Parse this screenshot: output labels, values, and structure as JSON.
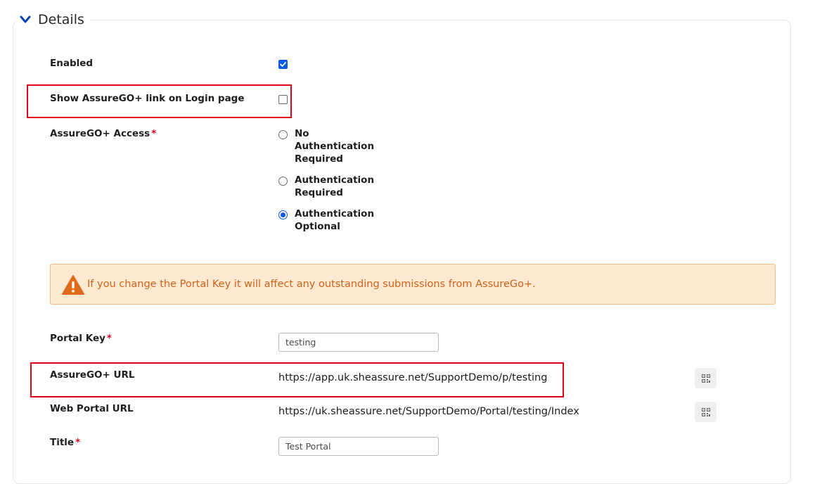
{
  "section": {
    "title": "Details"
  },
  "fields": {
    "enabled": {
      "label": "Enabled",
      "checked": true
    },
    "show_link": {
      "label": "Show AssureGO+ link on Login page",
      "checked": false
    },
    "access": {
      "label": "AssureGO+ Access",
      "required_mark": "*",
      "options": [
        {
          "line1": "No",
          "line2": "Authentication",
          "line3": "Required",
          "selected": false
        },
        {
          "line1": "Authentication",
          "line2": "Required",
          "selected": false
        },
        {
          "line1": "Authentication",
          "line2": "Optional",
          "selected": true
        }
      ]
    },
    "portal_key": {
      "label": "Portal Key",
      "required_mark": "*",
      "value": "testing"
    },
    "assurego_url": {
      "label": "AssureGO+ URL",
      "value": "https://app.uk.sheassure.net/SupportDemo/p/testing"
    },
    "web_portal_url": {
      "label": "Web Portal URL",
      "value": "https://uk.sheassure.net/SupportDemo/Portal/testing/Index"
    },
    "title": {
      "label": "Title",
      "required_mark": "*",
      "value": "Test Portal"
    }
  },
  "alert": {
    "icon": "warning-triangle-icon",
    "text": "If you change the Portal Key it will affect any outstanding submissions from AssureGo+."
  },
  "colors": {
    "accent": "#0a58e6",
    "required": "#e3001b",
    "alert_bg": "#fde9d2",
    "alert_text": "#d0621b",
    "highlight": "#e0001a"
  }
}
